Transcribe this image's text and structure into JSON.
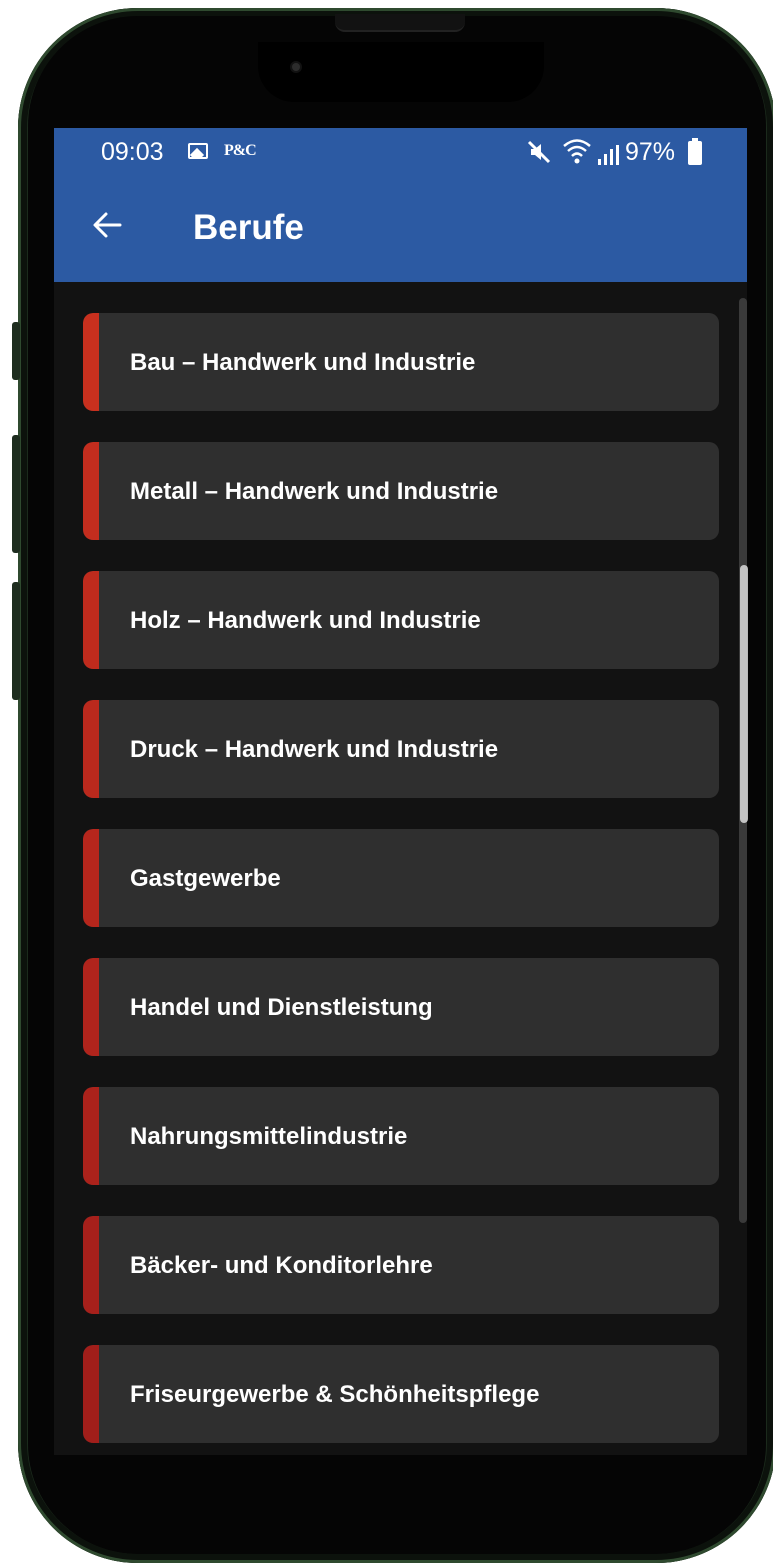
{
  "status_bar": {
    "time": "09:03",
    "notification_icons": [
      "image-icon",
      "pc-icon"
    ],
    "pc_label": "P&C",
    "system_icons": [
      "mute-icon",
      "wifi-icon",
      "signal-icon"
    ],
    "battery": "97%"
  },
  "app_bar": {
    "back_icon": "arrow-left-icon",
    "title": "Berufe",
    "color": "#2c5aa3"
  },
  "list": {
    "accent_color": "#c0281d",
    "items": [
      {
        "label": "Bau – Handwerk und Industrie",
        "accent": "#c8301e"
      },
      {
        "label": "Metall – Handwerk und Industrie",
        "accent": "#c32d1e"
      },
      {
        "label": "Holz – Handwerk und Industrie",
        "accent": "#bf2b1d"
      },
      {
        "label": "Druck – Handwerk und Industrie",
        "accent": "#ba291d"
      },
      {
        "label": "Gastgewerbe",
        "accent": "#b5261c"
      },
      {
        "label": "Handel und Dienstleistung",
        "accent": "#b0241c"
      },
      {
        "label": "Nahrungsmittelindustrie",
        "accent": "#ab221b"
      },
      {
        "label": "Bäcker- und Konditorlehre",
        "accent": "#a6201b"
      },
      {
        "label": "Friseurgewerbe & Schönheitspflege",
        "accent": "#a11e1a"
      }
    ]
  }
}
